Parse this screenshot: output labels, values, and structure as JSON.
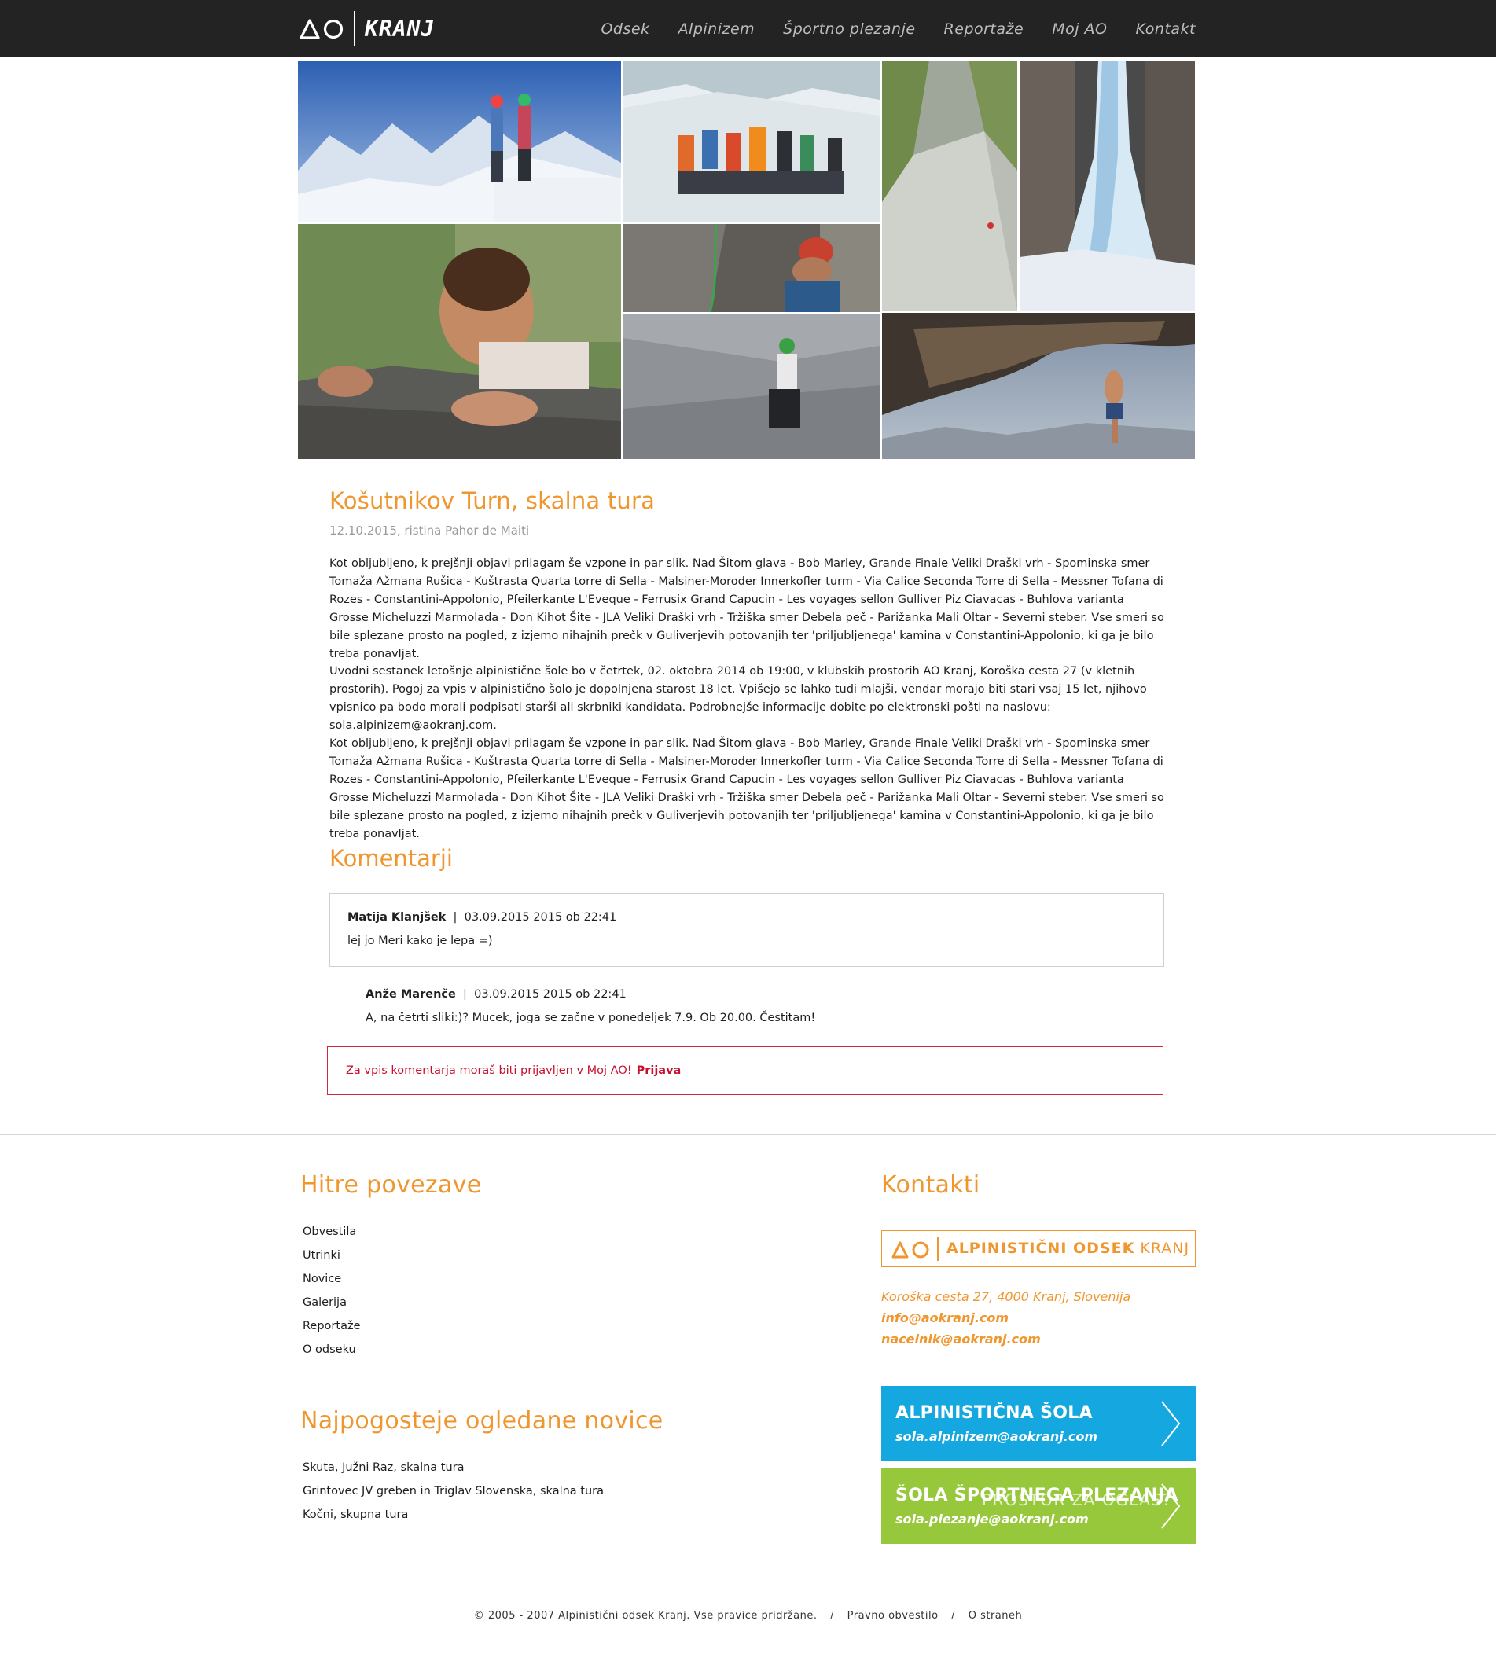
{
  "header": {
    "logo_text": "KRANJ",
    "nav": [
      "Odsek",
      "Alpinizem",
      "Športno plezanje",
      "Reportaže",
      "Moj AO",
      "Kontakt"
    ]
  },
  "article": {
    "title": "Košutnikov Turn, skalna tura",
    "meta": "12.10.2015, ristina Pahor de Maiti",
    "p1": "Kot obljubljeno, k prejšnji objavi prilagam še vzpone in par slik. Nad Šitom glava - Bob Marley, Grande Finale Veliki Draški vrh - Spominska smer Tomaža Ažmana Rušica - Kuštrasta Quarta torre di Sella - Malsiner-Moroder Innerkofler turm - Via Calice Seconda Torre di Sella - Messner Tofana di Rozes - Constantini-Appolonio, Pfeilerkante L'Eveque - Ferrusix Grand Capucin - Les voyages sellon Gulliver Piz Ciavacas - Buhlova varianta Grosse Micheluzzi Marmolada - Don Kihot Šite - JLA Veliki Draški vrh - Tržiška smer Debela peč - Parižanka Mali Oltar - Severni steber. Vse smeri so bile splezane prosto na pogled, z izjemo nihajnih prečk v Guliverjevih potovanjih ter 'priljubljenega' kamina v Constantini-Appolonio, ki ga je bilo treba ponavljat.",
    "p2": "Uvodni sestanek letošnje alpinistične šole bo v četrtek, 02. oktobra 2014 ob 19:00, v klubskih prostorih AO Kranj, Koroška cesta 27 (v kletnih prostorih). Pogoj za vpis v alpinistično šolo je dopolnjena starost 18 let. Vpišejo se lahko tudi mlajši, vendar morajo biti stari vsaj 15 let, njihovo vpisnico pa bodo morali podpisati starši ali skrbniki kandidata. Podrobnejše informacije dobite po elektronski pošti na naslovu: sola.alpinizem@aokranj.com.",
    "p3": "Kot obljubljeno, k prejšnji objavi prilagam še vzpone in par slik. Nad Šitom glava - Bob Marley, Grande Finale Veliki Draški vrh - Spominska smer Tomaža Ažmana Rušica - Kuštrasta Quarta torre di Sella - Malsiner-Moroder Innerkofler turm - Via Calice Seconda Torre di Sella - Messner Tofana di Rozes - Constantini-Appolonio, Pfeilerkante L'Eveque - Ferrusix Grand Capucin - Les voyages sellon Gulliver Piz Ciavacas - Buhlova varianta Grosse Micheluzzi Marmolada - Don Kihot Šite - JLA Veliki Draški vrh - Tržiška smer Debela peč - Parižanka Mali Oltar - Severni steber. Vse smeri so bile splezane prosto na pogled, z izjemo nihajnih prečk v Guliverjevih potovanjih ter 'priljubljenega' kamina v Constantini-Appolonio, ki ga je bilo treba ponavljat."
  },
  "comments": {
    "title": "Komentarji",
    "items": [
      {
        "author": "Matija Klanjšek",
        "sep": "|",
        "date": "03.09.2015 2015 ob 22:41",
        "text": "lej jo Meri kako je lepa =)"
      },
      {
        "author": "Anže Marenče",
        "sep": "|",
        "date": "03.09.2015 2015 ob 22:41",
        "text": "A, na četrti sliki:)? Mucek, joga se začne v ponedeljek 7.9. Ob 20.00. Čestitam!"
      }
    ],
    "login_msg": "Za vpis komentarja moraš biti prijavljen v Moj AO!",
    "login_link": "Prijava"
  },
  "quick_links": {
    "title": "Hitre povezave",
    "items": [
      "Obvestila",
      "Utrinki",
      "Novice",
      "Galerija",
      "Reportaže",
      "O odseku"
    ]
  },
  "most_viewed": {
    "title": "Najpogosteje ogledane novice",
    "items": [
      "Skuta, Južni Raz, skalna tura",
      "Grintovec JV greben in Triglav Slovenska, skalna tura",
      "Kočni, skupna tura"
    ]
  },
  "contacts": {
    "title": "Kontakti",
    "brand_bold": "ALPINISTIČNI ODSEK",
    "brand_light": "KRANJ",
    "address": "Koroška cesta 27, 4000 Kranj, Slovenija",
    "email1": "info@aokranj.com",
    "email2": "nacelnik@aokranj.com"
  },
  "cta": [
    {
      "title": "ALPINISTIČNA ŠOLA",
      "email": "sola.alpinizem@aokranj.com",
      "overlay": "",
      "color": "#14a7e0"
    },
    {
      "title": "ŠOLA ŠPORTNEGA PLEZANJA",
      "email": "sola.plezanje@aokranj.com",
      "overlay": "PROSTOR ZA OGLAS?",
      "color": "#97c83c"
    }
  ],
  "footer": {
    "copyright": "© 2005 - 2007 Alpinistični odsek Kranj. Vse pravice pridržane.",
    "sep": "/",
    "legal": "Pravno obvestilo",
    "about": "O straneh"
  },
  "colors": {
    "accent": "#f0962e",
    "header_bg": "#232323",
    "alert": "#c8102e"
  }
}
